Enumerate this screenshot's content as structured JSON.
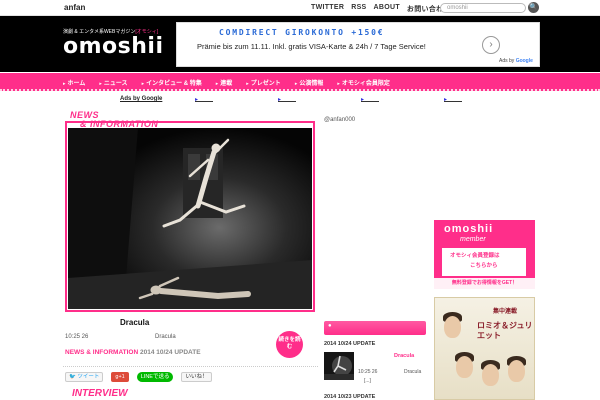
{
  "topbar": {
    "brand": "anfan",
    "links": [
      "TWITTER",
      "RSS",
      "ABOUT",
      "お問い合わせ"
    ],
    "search_placeholder": "omoshii",
    "search_button": "🔍"
  },
  "header": {
    "tagline_prefix": "演劇 & エンタメ系WEBマガジン",
    "tagline_accent": "[オモシィ]",
    "logo": "omoshii"
  },
  "ad": {
    "title": "COMDIRECT GIROKONTO +150€",
    "text": "Prämie bis zum 11.11. Inkl. gratis VISA-Karte & 24h / 7 Tage Service!",
    "arrow": "›",
    "ads_by": "Ads by",
    "google": "Google"
  },
  "nav": {
    "items": [
      "ホーム",
      "ニュース",
      "インタビュー & 特集",
      "連載",
      "プレゼント",
      "公演情報",
      "オモシィ会員限定"
    ]
  },
  "ads_strip": {
    "label": "Ads by Google",
    "links": [
      "",
      "",
      "",
      ""
    ]
  },
  "news": {
    "heading_line1": "NEWS",
    "heading_line2": "& INFORMATION"
  },
  "article": {
    "title": "Dracula",
    "time": "10:25  26",
    "subtitle": "Dracula",
    "category": "NEWS & INFORMATION",
    "date": "2014 10/24 UPDATE",
    "readmore": "続きを読む"
  },
  "share": {
    "twitter": "ツイート",
    "gplus": "g+1",
    "line": "LINEで送る",
    "like": "いいね！"
  },
  "interview_heading": "INTERVIEW",
  "middle": {
    "handle": "@anfan000",
    "update_date": "2014 10/24 UPDATE",
    "update_title": "Dracula",
    "update_time": "10:25  26",
    "update_sub": "Dracula",
    "update_more": "[...]",
    "update_date2": "2014 10/23 UPDATE"
  },
  "right": {
    "member_logo": "omoshii",
    "member_word": "member",
    "member_line1": "オモシィ会員登録は",
    "member_line2": "こちらから",
    "member_footer": "無料登録でお得情報をGET！",
    "romeo_sub": "集中連載",
    "romeo_title": "ロミオ＆ジュリエット"
  }
}
